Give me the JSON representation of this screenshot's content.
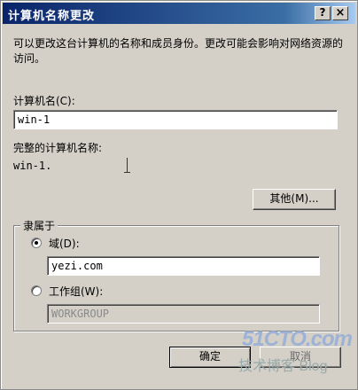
{
  "window": {
    "title": "计算机名称更改",
    "help_label": "?",
    "close_label": "×"
  },
  "description": "可以更改这台计算机的名称和成员身份。更改可能会影响对网络资源的访问。",
  "computer_name": {
    "label": "计算机名(C):",
    "value": "win-1"
  },
  "full_name": {
    "label": "完整的计算机名称:",
    "value": "win-1."
  },
  "more_button": "其他(M)...",
  "member_of": {
    "legend": "隶属于",
    "domain_label": "域(D):",
    "domain_value": "yezi.com",
    "domain_selected": true,
    "workgroup_label": "工作组(W):",
    "workgroup_value": "WORKGROUP",
    "workgroup_selected": false
  },
  "buttons": {
    "ok": "确定",
    "cancel": "取消"
  },
  "watermark": {
    "line1": "51CTO.com",
    "line2": "技术博客 Blog"
  }
}
